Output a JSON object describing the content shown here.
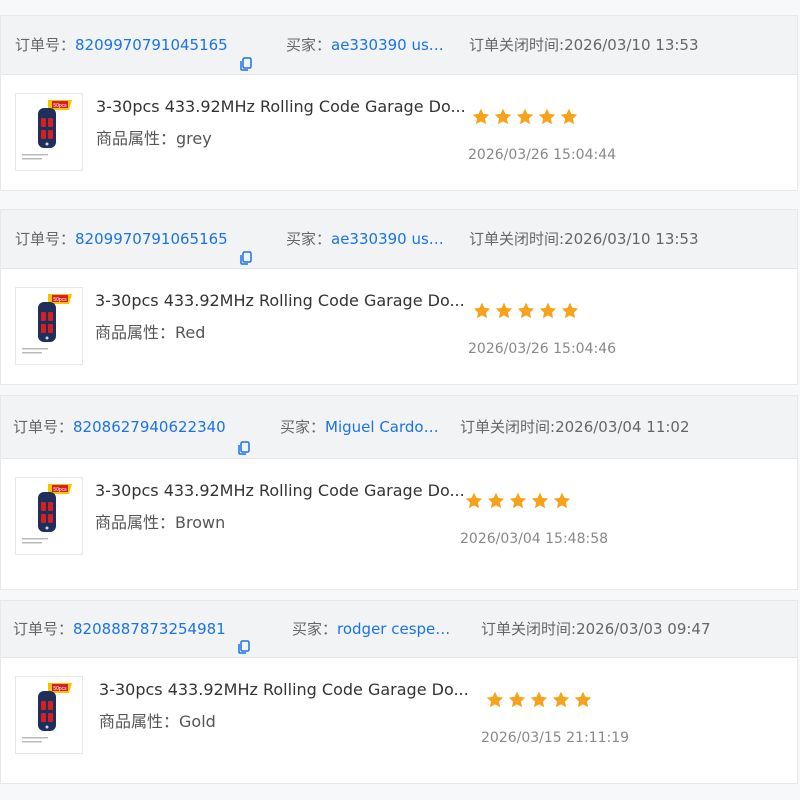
{
  "labels": {
    "order_no": "订单号：",
    "buyer": "买家：",
    "close_time": "订单关闭时间:",
    "attribute": "商品属性："
  },
  "colors": {
    "link": "#1a73e8",
    "star": "#f7a21b",
    "header_bg": "#f2f3f5"
  },
  "icons": {
    "copy": "copy-icon",
    "star": "star-icon"
  },
  "orders": [
    {
      "order_id": "8209970791045165",
      "buyer": "ae330390 user...",
      "close_time": "2026/03/10 13:53",
      "product_title": "3-30pcs 433.92MHz Rolling Code Garage Do...",
      "attribute_value": "grey",
      "rating": 5,
      "eval_time": "2026/03/26 15:04:44",
      "badge": "50pcs"
    },
    {
      "order_id": "8209970791065165",
      "buyer": "ae330390 user...",
      "close_time": "2026/03/10 13:53",
      "product_title": "3-30pcs 433.92MHz Rolling Code Garage Do...",
      "attribute_value": "Red",
      "rating": 5,
      "eval_time": "2026/03/26 15:04:46",
      "badge": "50pcs"
    },
    {
      "order_id": "8208627940622340",
      "buyer": "Miguel Cardona...",
      "close_time": "2026/03/04 11:02",
      "product_title": "3-30pcs 433.92MHz Rolling Code Garage Do...",
      "attribute_value": "Brown",
      "rating": 5,
      "eval_time": "2026/03/04 15:48:58",
      "badge": "50pcs"
    },
    {
      "order_id": "8208887873254981",
      "buyer": "rodger cespede...",
      "close_time": "2026/03/03 09:47",
      "product_title": "3-30pcs 433.92MHz Rolling Code Garage Do...",
      "attribute_value": "Gold",
      "rating": 5,
      "eval_time": "2026/03/15 21:11:19",
      "badge": "50pcs"
    }
  ]
}
